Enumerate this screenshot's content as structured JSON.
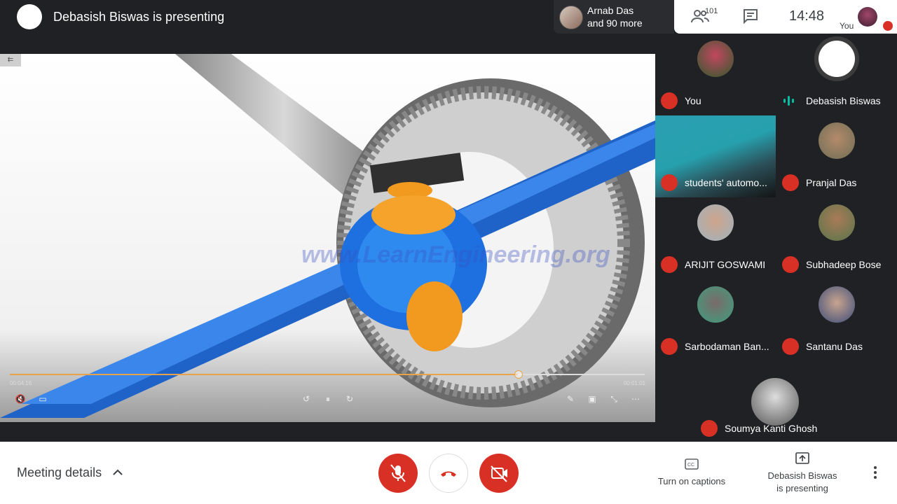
{
  "topbar": {
    "presenter_title": "Debasish Biswas is presenting",
    "joined_line1": "Arnab Das",
    "joined_line2": "and 90 more",
    "people_count": "101",
    "time": "14:48",
    "you_label": "You"
  },
  "video": {
    "elapsed": "00:04:16",
    "total": "00:01:01",
    "progress_fraction": 0.8,
    "watermark": "www.LearnEngineering.org",
    "rewind_chip": "⇇"
  },
  "participants": [
    {
      "name": "You",
      "muted": true
    },
    {
      "name": "Debasish Biswas",
      "muted": false,
      "speaking": true
    },
    {
      "name": "students' automo...",
      "muted": true
    },
    {
      "name": "Pranjal Das",
      "muted": true
    },
    {
      "name": "ARIJIT GOSWAMI",
      "muted": true
    },
    {
      "name": "Subhadeep Bose",
      "muted": true
    },
    {
      "name": "Sarbodaman Ban...",
      "muted": true
    },
    {
      "name": "Santanu Das",
      "muted": true
    },
    {
      "name": "Soumya Kanti Ghosh",
      "muted": true
    }
  ],
  "bottombar": {
    "meeting_details": "Meeting details",
    "captions_label": "Turn on captions",
    "presenting_line1": "Debasish Biswas",
    "presenting_line2": "is presenting"
  },
  "colors": {
    "bg_dark": "#202124",
    "mute_red": "#d93025",
    "gear_blue": "#1f6fdc",
    "gear_orange": "#f29a1f",
    "speaking_teal": "#00bfa5"
  }
}
